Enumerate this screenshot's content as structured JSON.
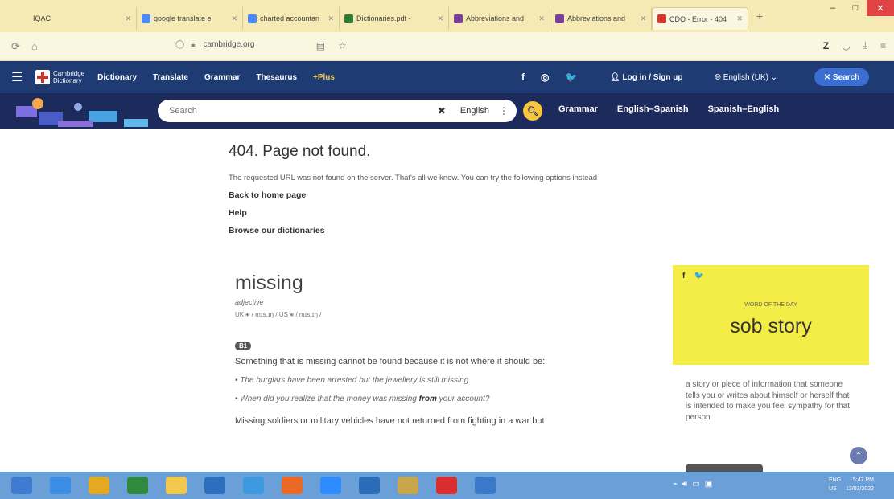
{
  "browser": {
    "tabs": [
      {
        "label": "IQAC",
        "color": "#f6eab4",
        "active": false
      },
      {
        "label": "google translate e",
        "color": "#4a8bf5",
        "active": false
      },
      {
        "label": "charted accountan",
        "color": "#4a8bf5",
        "active": false
      },
      {
        "label": "Dictionaries.pdf - ",
        "color": "#2e7d32",
        "active": false
      },
      {
        "label": "Abbreviations and",
        "color": "#7b3fa0",
        "active": false
      },
      {
        "label": "Abbreviations and",
        "color": "#7b3fa0",
        "active": false
      },
      {
        "label": "CDO - Error - 404",
        "color": "#d7372b",
        "active": true
      }
    ],
    "new_tab_label": "+",
    "url_host": "cambridge.org",
    "window_controls": {
      "minimize": "–",
      "maximize": "□",
      "close": "✕"
    }
  },
  "site": {
    "logo_line1": "Cambridge",
    "logo_line2": "Dictionary",
    "nav": [
      "Dictionary",
      "Translate",
      "Grammar",
      "Thesaurus",
      "+Plus"
    ],
    "social": [
      "f",
      "◎",
      "🐦"
    ],
    "login": "Log in / Sign up",
    "language": "English (UK)",
    "search_button": "Search",
    "search_placeholder": "Search",
    "search_language": "English",
    "sublinks": [
      "Grammar",
      "English–Spanish",
      "Spanish–English"
    ]
  },
  "error": {
    "title": "404. Page not found.",
    "message": "The requested URL was not found on the server. That's all we know. You can try the following options instead",
    "options": [
      "Back to home page",
      "Help",
      "Browse our dictionaries"
    ]
  },
  "entry": {
    "headword": "missing",
    "pos": "adjective",
    "uk_label": "UK",
    "uk_ipa": "/ mɪs.ɪŋ /",
    "us_label": "US",
    "us_ipa": "/ mɪs.ɪŋ /",
    "level": "B1",
    "definition": "Something that is missing cannot be found because it is not where it should be:",
    "example1": "The burglars have been arrested but the jewellery is still missing",
    "example2_pre": "When did you realize that the money was missing ",
    "example2_bold": "from",
    "example2_post": " your account?",
    "definition2": "Missing soldiers or military vehicles have not returned from fighting in a war but"
  },
  "word_of_the_day": {
    "facebook": "f",
    "twitter": "🐦",
    "tag": "WORD OF THE DAY",
    "word": "sob story",
    "definition": "a story or piece of information that someone tells you or writes about himself or herself that is intended to make you feel sympathy for that person"
  },
  "taskbar": {
    "apps": [
      {
        "name": "start",
        "color": "#3f7bd0"
      },
      {
        "name": "edge",
        "color": "#3a8ee6"
      },
      {
        "name": "chrome",
        "color": "#e5a823"
      },
      {
        "name": "store",
        "color": "#2f8a3e"
      },
      {
        "name": "files",
        "color": "#f2c94c"
      },
      {
        "name": "browser",
        "color": "#2d6fbf"
      },
      {
        "name": "telegram",
        "color": "#3d9ae0"
      },
      {
        "name": "firefox",
        "color": "#e86a24"
      },
      {
        "name": "zoom",
        "color": "#2d8cff"
      },
      {
        "name": "whiteboard",
        "color": "#2a6cb8"
      },
      {
        "name": "media",
        "color": "#c8a64a"
      },
      {
        "name": "acrobat",
        "color": "#d92e2e"
      },
      {
        "name": "word",
        "color": "#3a79c9"
      }
    ],
    "lang1": "ENG",
    "lang2": "US",
    "time": "5:47 PM",
    "date": "13/03/2022"
  }
}
